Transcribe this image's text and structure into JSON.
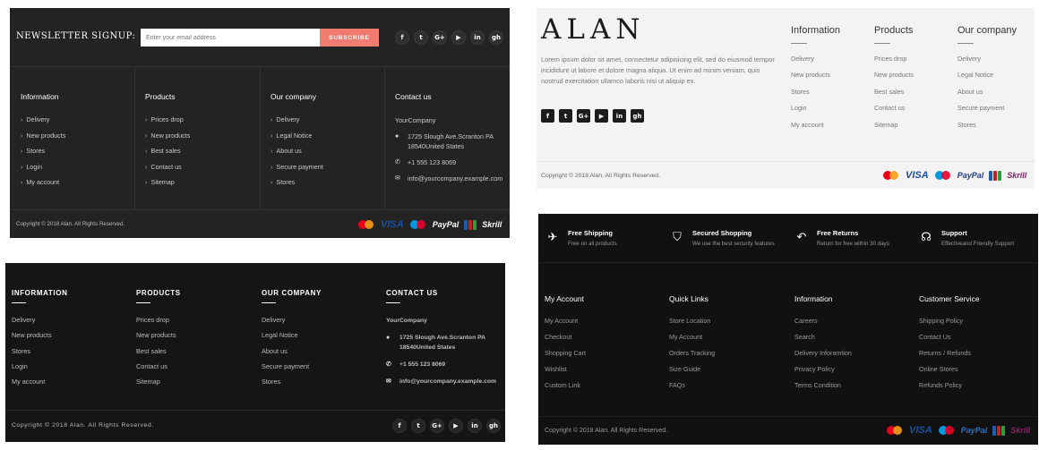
{
  "footer1": {
    "newsletter_label": "NEWSLETTER SIGNUP:",
    "email_placeholder": "Enter your email address",
    "subscribe_label": "SUBSCRIBE",
    "social": [
      "f",
      "t",
      "G+",
      "▶",
      "in",
      "gh"
    ],
    "columns": [
      {
        "title": "Information",
        "items": [
          "Delivery",
          "New products",
          "Stores",
          "Login",
          "My account"
        ]
      },
      {
        "title": "Products",
        "items": [
          "Prices drop",
          "New products",
          "Best sales",
          "Contact us",
          "Sitemap"
        ]
      },
      {
        "title": "Our company",
        "items": [
          "Delivery",
          "Legal Notice",
          "About us",
          "Secure payment",
          "Stores"
        ]
      }
    ],
    "contact": {
      "title": "Contact us",
      "company": "YourCompany",
      "address": "1725 Slough Ave.Scranton PA 18540United States",
      "phone": "+1 555 123 8069",
      "email": "info@yourcompany.example.com"
    },
    "copyright": "Copyright © 2018 Alan. All Rights Reserved.",
    "payments": {
      "visa": "VISA",
      "paypal": "PayPal",
      "skrill": "Skrill"
    }
  },
  "footer2": {
    "columns": [
      {
        "title": "INFORMATION",
        "items": [
          "Delivery",
          "New products",
          "Stores",
          "Login",
          "My account"
        ]
      },
      {
        "title": "PRODUCTS",
        "items": [
          "Prices drop",
          "New products",
          "Best sales",
          "Contact us",
          "Sitemap"
        ]
      },
      {
        "title": "OUR COMPANY",
        "items": [
          "Delivery",
          "Legal Notice",
          "About us",
          "Secure payment",
          "Stores"
        ]
      }
    ],
    "contact": {
      "title": "CONTACT US",
      "company": "YourCompany",
      "address": "1725 Slough Ave.Scranton PA 18540United States",
      "phone": "+1 555 123 8069",
      "email": "info@yourcompany.example.com"
    },
    "copyright": "Copyright © 2018 Alan. All Rights Reserved.",
    "social": [
      "f",
      "t",
      "G+",
      "▶",
      "in",
      "gh"
    ]
  },
  "footer3": {
    "logo": "ALAN",
    "description": "Lorem ipsum dolor sit amet, consectetur adipisicing elit, sed do eiusmod tempor incididunt ut labore et dolore magna aliqua. Ut enim ad minim veniam, quis nostrud exercitation ullamco laboris nisi ut aliquip ex.",
    "social": [
      "f",
      "t",
      "G+",
      "▶",
      "in",
      "gh"
    ],
    "columns": [
      {
        "title": "Information",
        "items": [
          "Delivery",
          "New products",
          "Stores",
          "Login",
          "My account"
        ]
      },
      {
        "title": "Products",
        "items": [
          "Prices drop",
          "New products",
          "Best sales",
          "Contact us",
          "Sitemap"
        ]
      },
      {
        "title": "Our company",
        "items": [
          "Delivery",
          "Legal Notice",
          "About us",
          "Secure payment",
          "Stores"
        ]
      }
    ],
    "copyright": "Copyright © 2018 Alan. All Rights Reserved.",
    "payments": {
      "visa": "VISA",
      "paypal": "PayPal",
      "skrill": "Skrill"
    }
  },
  "footer4": {
    "features": [
      {
        "title": "Free Shipping",
        "text": "Free on all products"
      },
      {
        "title": "Secured Shopping",
        "text": "We use the best security features"
      },
      {
        "title": "Free Returns",
        "text": "Return for free within 30 days"
      },
      {
        "title": "Support",
        "text": "Effectiveand Friendly Support"
      }
    ],
    "columns": [
      {
        "title": "My Account",
        "items": [
          "My Account",
          "Checkout",
          "Shopping Cart",
          "Wishlist",
          "Custom Link"
        ]
      },
      {
        "title": "Quick Links",
        "items": [
          "Store Location",
          "My Account",
          "Orders Tracking",
          "Size Guide",
          "FAQs"
        ]
      },
      {
        "title": "Information",
        "items": [
          "Careers",
          "Search",
          "Delivery Inforamtion",
          "Privacy Policy",
          "Terms Condition"
        ]
      },
      {
        "title": "Customer Service",
        "items": [
          "Shipping Policy",
          "Contact Us",
          "Returns / Refunds",
          "Online Stores",
          "Refunds Policy"
        ]
      }
    ],
    "copyright": "Copyright © 2018 Alan. All Rights Reserved.",
    "payments": {
      "visa": "VISA",
      "paypal": "PayPal",
      "skrill": "Skrill"
    }
  }
}
